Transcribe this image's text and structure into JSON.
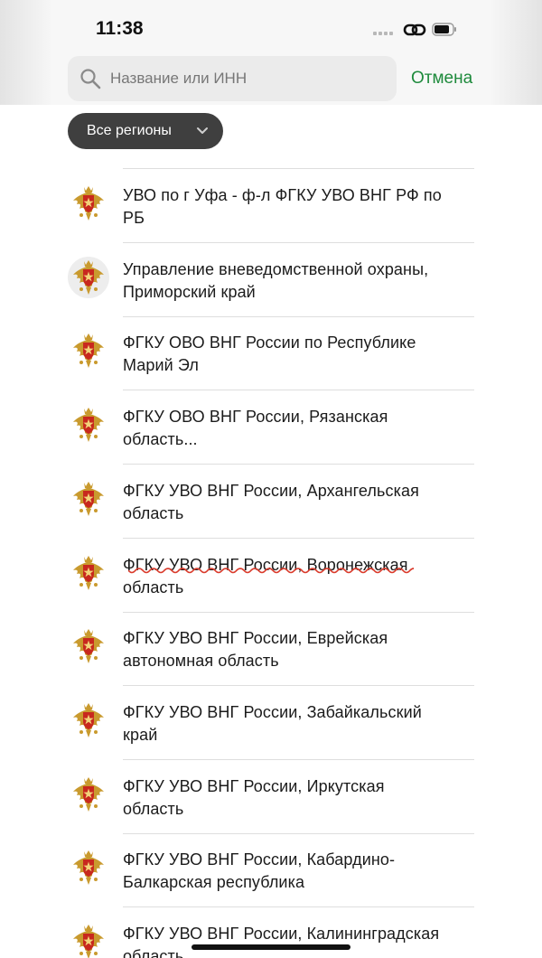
{
  "status_bar": {
    "time": "11:38"
  },
  "search": {
    "placeholder": "Название или ИНН",
    "value": "",
    "cancel_label": "Отмена"
  },
  "filter": {
    "region_label": "Все регионы"
  },
  "icons": {
    "search": "search-icon",
    "chevron": "chevron-down-icon",
    "emblem": "rosgvardia-emblem-icon",
    "link": "link-icon",
    "battery": "battery-icon"
  },
  "colors": {
    "accent_green": "#1e8a3c",
    "chip_bg": "#3f3f3f",
    "emblem_gold": "#c99a2e",
    "emblem_red": "#c8281e",
    "spellcheck_red": "#d93a2b"
  },
  "organizations": [
    {
      "name_line1": "УВО по г Уфа - ф-л ФГКУ УВО ВНГ РФ по",
      "name_line2": "РБ"
    },
    {
      "name_line1": "Управление вневедомственной охраны,",
      "name_line2": "Приморский край"
    },
    {
      "name_line1": "ФГКУ ОВО ВНГ России по Республике",
      "name_line2": "Марий Эл"
    },
    {
      "name_line1": "ФГКУ ОВО ВНГ России, Рязанская",
      "name_line2": "область..."
    },
    {
      "name_line1": "ФГКУ УВО ВНГ России, Архангельская",
      "name_line2": "область"
    },
    {
      "name_line1": "ФГКУ УВО ВНГ России, Воронежская",
      "name_line2": "область"
    },
    {
      "name_line1": "ФГКУ УВО ВНГ России, Еврейская",
      "name_line2": "автономная область"
    },
    {
      "name_line1": "ФГКУ УВО ВНГ России, Забайкальский",
      "name_line2": "край"
    },
    {
      "name_line1": "ФГКУ УВО ВНГ России, Иркутская",
      "name_line2": "область"
    },
    {
      "name_line1": "ФГКУ УВО ВНГ России, Кабардино-",
      "name_line2": "Балкарская республика"
    },
    {
      "name_line1": "ФГКУ УВО ВНГ России, Калининградская",
      "name_line2": "область"
    }
  ]
}
